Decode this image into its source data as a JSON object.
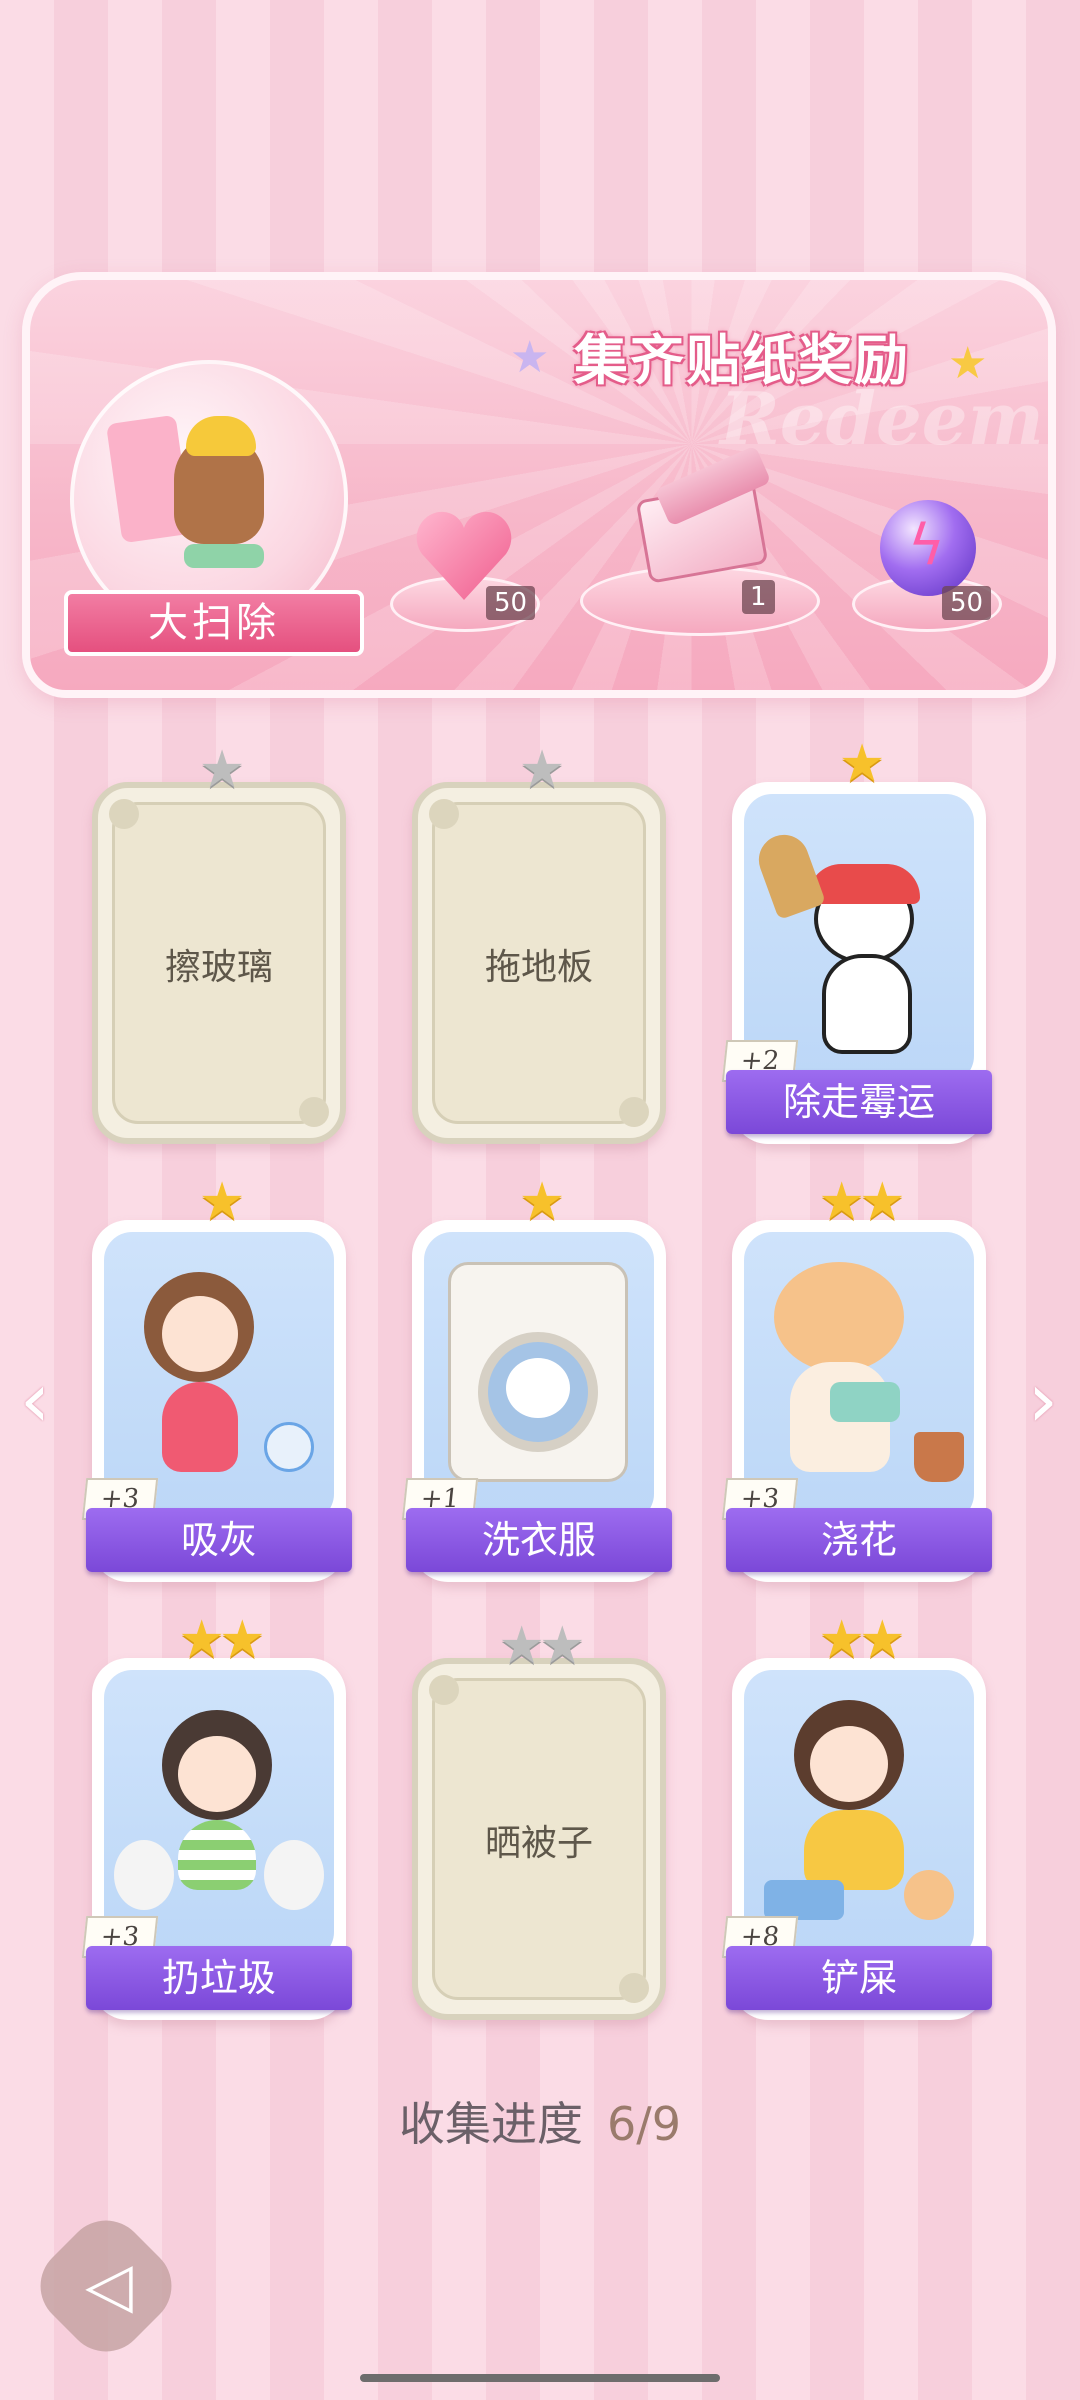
{
  "banner": {
    "title": "集齐贴纸奖励",
    "watermark": "Redeem",
    "theme_label": "大扫除",
    "rewards": [
      {
        "icon": "pink-heart-gem-icon",
        "count": "50"
      },
      {
        "icon": "gift-box-icon",
        "count": "1"
      },
      {
        "icon": "purple-lightning-orb-icon",
        "count": "50"
      }
    ]
  },
  "cards": [
    {
      "name": "擦玻璃",
      "stars": 1,
      "unlocked": false
    },
    {
      "name": "拖地板",
      "stars": 1,
      "unlocked": false
    },
    {
      "name": "除走霉运",
      "stars": 1,
      "unlocked": true,
      "bonus": "+2",
      "art": "panda-broom"
    },
    {
      "name": "吸灰",
      "stars": 1,
      "unlocked": true,
      "bonus": "+3",
      "art": "girl-vacuum"
    },
    {
      "name": "洗衣服",
      "stars": 1,
      "unlocked": true,
      "bonus": "+1",
      "art": "cat-washing-machine"
    },
    {
      "name": "浇花",
      "stars": 2,
      "unlocked": true,
      "bonus": "+3",
      "art": "cat-watering-plant"
    },
    {
      "name": "扔垃圾",
      "stars": 2,
      "unlocked": true,
      "bonus": "+3",
      "art": "girl-trash-bags"
    },
    {
      "name": "晒被子",
      "stars": 2,
      "unlocked": false
    },
    {
      "name": "铲屎",
      "stars": 2,
      "unlocked": true,
      "bonus": "+8",
      "art": "girl-litter-box"
    }
  ],
  "progress": {
    "label": "收集进度",
    "value": "6/9"
  },
  "nav": {
    "left_icon": "chevron-left-icon",
    "right_icon": "chevron-right-icon",
    "back_icon": "back-arrow-icon"
  },
  "colors": {
    "accent": "#e5507f",
    "band": "#7b48d8",
    "star": "#f7c12b"
  }
}
